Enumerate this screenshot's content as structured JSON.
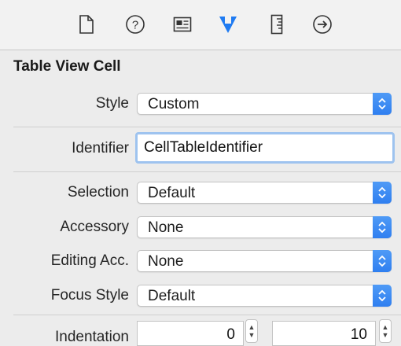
{
  "toolbar": {
    "icons": [
      "file-inspector-icon",
      "quick-help-icon",
      "identity-inspector-icon",
      "attributes-inspector-icon",
      "size-inspector-icon",
      "connections-inspector-icon"
    ],
    "accent": "#2f7ff0"
  },
  "section": {
    "title": "Table View Cell"
  },
  "fields": {
    "style": {
      "label": "Style",
      "value": "Custom"
    },
    "identifier": {
      "label": "Identifier",
      "value": "CellTableIdentifier"
    },
    "selection": {
      "label": "Selection",
      "value": "Default"
    },
    "accessory": {
      "label": "Accessory",
      "value": "None"
    },
    "editing_acc": {
      "label": "Editing Acc.",
      "value": "None"
    },
    "focus_style": {
      "label": "Focus Style",
      "value": "Default"
    },
    "indentation": {
      "label": "Indentation",
      "level": "0",
      "width": "10"
    }
  }
}
